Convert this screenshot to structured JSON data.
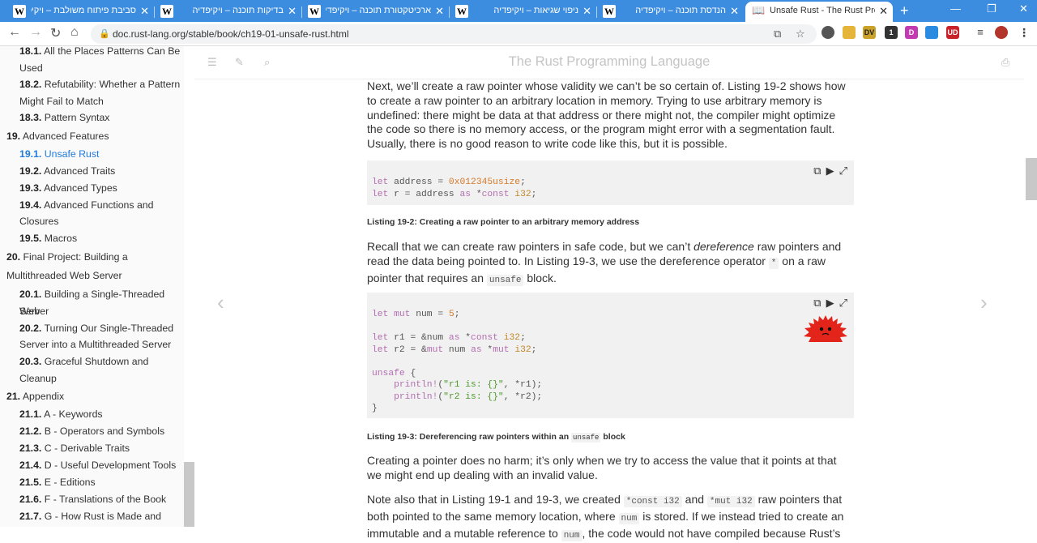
{
  "browser": {
    "tabs": [
      {
        "title": "סביבת פיתוח משולבת – ויקיפד",
        "favicon": "W"
      },
      {
        "title": "בדיקות תוכנה – ויקיפדיה",
        "favicon": "W"
      },
      {
        "title": "ארכיטקטורת תוכנה – ויקיפדיה",
        "favicon": "W"
      },
      {
        "title": "ניפוי שגיאות – ויקיפדיה",
        "favicon": "W"
      },
      {
        "title": "הנדסת תוכנה – ויקיפדיה",
        "favicon": "W"
      },
      {
        "title": "Unsafe Rust - The Rust Program",
        "favicon": "book"
      }
    ],
    "url": "doc.rust-lang.org/stable/book/ch19-01-unsafe-rust.html",
    "extensions": [
      "DV",
      "1",
      "D",
      "UD"
    ]
  },
  "sidebar": {
    "items": [
      {
        "num": "18.1.",
        "label": "All the Places Patterns Can Be"
      },
      {
        "num": "",
        "label": "Used"
      },
      {
        "num": "18.2.",
        "label": "Refutability: Whether a Pattern"
      },
      {
        "num": "",
        "label": "Might Fail to Match"
      },
      {
        "num": "18.3.",
        "label": "Pattern Syntax"
      },
      {
        "num": "19.",
        "label": "Advanced Features"
      },
      {
        "num": "19.1.",
        "label": "Unsafe Rust"
      },
      {
        "num": "19.2.",
        "label": "Advanced Traits"
      },
      {
        "num": "19.3.",
        "label": "Advanced Types"
      },
      {
        "num": "19.4.",
        "label": "Advanced Functions and"
      },
      {
        "num": "",
        "label": "Closures"
      },
      {
        "num": "19.5.",
        "label": "Macros"
      },
      {
        "num": "20.",
        "label": "Final Project: Building a"
      },
      {
        "num": "",
        "label": "Multithreaded Web Server"
      },
      {
        "num": "20.1.",
        "label": "Building a Single-Threaded Web"
      },
      {
        "num": "",
        "label": "Server"
      },
      {
        "num": "20.2.",
        "label": "Turning Our Single-Threaded"
      },
      {
        "num": "",
        "label": "Server into a Multithreaded Server"
      },
      {
        "num": "20.3.",
        "label": "Graceful Shutdown and"
      },
      {
        "num": "",
        "label": "Cleanup"
      },
      {
        "num": "21.",
        "label": "Appendix"
      },
      {
        "num": "21.1.",
        "label": "A - Keywords"
      },
      {
        "num": "21.2.",
        "label": "B - Operators and Symbols"
      },
      {
        "num": "21.3.",
        "label": "C - Derivable Traits"
      },
      {
        "num": "21.4.",
        "label": "D - Useful Development Tools"
      },
      {
        "num": "21.5.",
        "label": "E - Editions"
      },
      {
        "num": "21.6.",
        "label": "F - Translations of the Book"
      },
      {
        "num": "21.7.",
        "label": "G - How Rust is Made and"
      }
    ]
  },
  "header": {
    "book_title": "The Rust Programming Language"
  },
  "content": {
    "p1": "Next, we’ll create a raw pointer whose validity we can’t be so certain of. Listing 19-2 shows how to create a raw pointer to an arbitrary location in memory. Trying to use arbitrary memory is undefined: there might be data at that address or there might not, the compiler might optimize the code so there is no memory access, or the program might error with a segmentation fault. Usually, there is no good reason to write code like this, but it is possible.",
    "caption1": "Listing 19-2: Creating a raw pointer to an arbitrary memory address",
    "p2_a": "Recall that we can create raw pointers in safe code, but we can’t ",
    "p2_em": "dereference",
    "p2_b": " raw pointers and read the data being pointed to. In Listing 19-3, we use the dereference operator ",
    "p2_code1": "*",
    "p2_c": " on a raw pointer that requires an ",
    "p2_code2": "unsafe",
    "p2_d": " block.",
    "caption2_a": "Listing 19-3: Dereferencing raw pointers within an ",
    "caption2_code": "unsafe",
    "caption2_b": " block",
    "p3": "Creating a pointer does no harm; it’s only when we try to access the value that it points at that we might end up dealing with an invalid value.",
    "p4_a": "Note also that in Listing 19-1 and 19-3, we created ",
    "p4_code1": "*const i32",
    "p4_b": " and ",
    "p4_code2": "*mut i32",
    "p4_c": " raw pointers that both pointed to the same memory location, where ",
    "p4_code3": "num",
    "p4_d": " is stored. If we instead tried to create an",
    "p4_e": "immutable and a mutable reference to",
    "p4_code4": "num",
    "p4_f": ", the code would not have compiled because Rust’s"
  },
  "colors": {
    "accent": "#1f7bdc",
    "tabbar": "#3c8de0",
    "code_bg": "#f1f1f1"
  }
}
